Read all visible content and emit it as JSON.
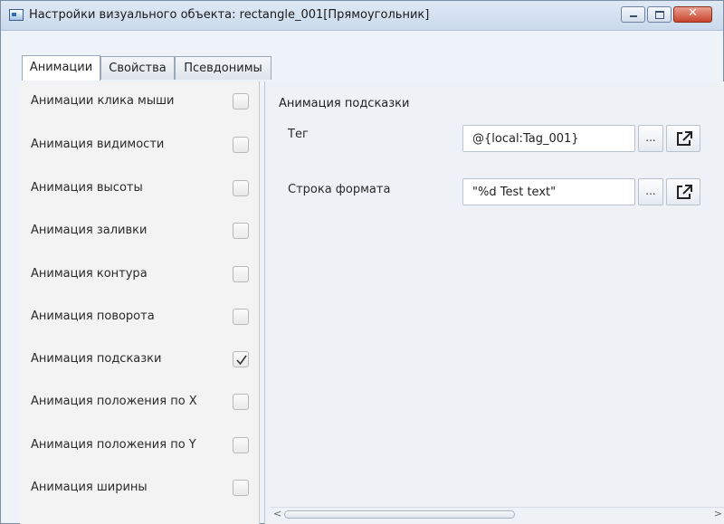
{
  "window": {
    "title": "Настройки визуального объекта: rectangle_001[Прямоугольник]",
    "close_symbol": "✕"
  },
  "tabs": [
    {
      "label": "Анимации",
      "active": true
    },
    {
      "label": "Свойства",
      "active": false
    },
    {
      "label": "Псевдонимы",
      "active": false
    }
  ],
  "animations": [
    {
      "label": "Анимации клика мыши",
      "checked": false
    },
    {
      "label": "Анимация видимости",
      "checked": false
    },
    {
      "label": "Анимация высоты",
      "checked": false
    },
    {
      "label": "Анимация заливки",
      "checked": false
    },
    {
      "label": "Анимация контура",
      "checked": false
    },
    {
      "label": "Анимация поворота",
      "checked": false
    },
    {
      "label": "Анимация подсказки",
      "checked": true
    },
    {
      "label": "Анимация положения по X",
      "checked": false
    },
    {
      "label": "Анимация положения по Y",
      "checked": false
    },
    {
      "label": "Анимация ширины",
      "checked": false
    }
  ],
  "detail": {
    "section_title": "Анимация подсказки",
    "tag_label": "Тег",
    "tag_value": "@{local:Tag_001}",
    "format_label": "Строка формата",
    "format_value": "\"%d Test text\"",
    "browse_label": "...",
    "open_icon": "external-link-icon"
  },
  "scrollbar": {
    "left_arrow": "<",
    "right_arrow": ">"
  }
}
